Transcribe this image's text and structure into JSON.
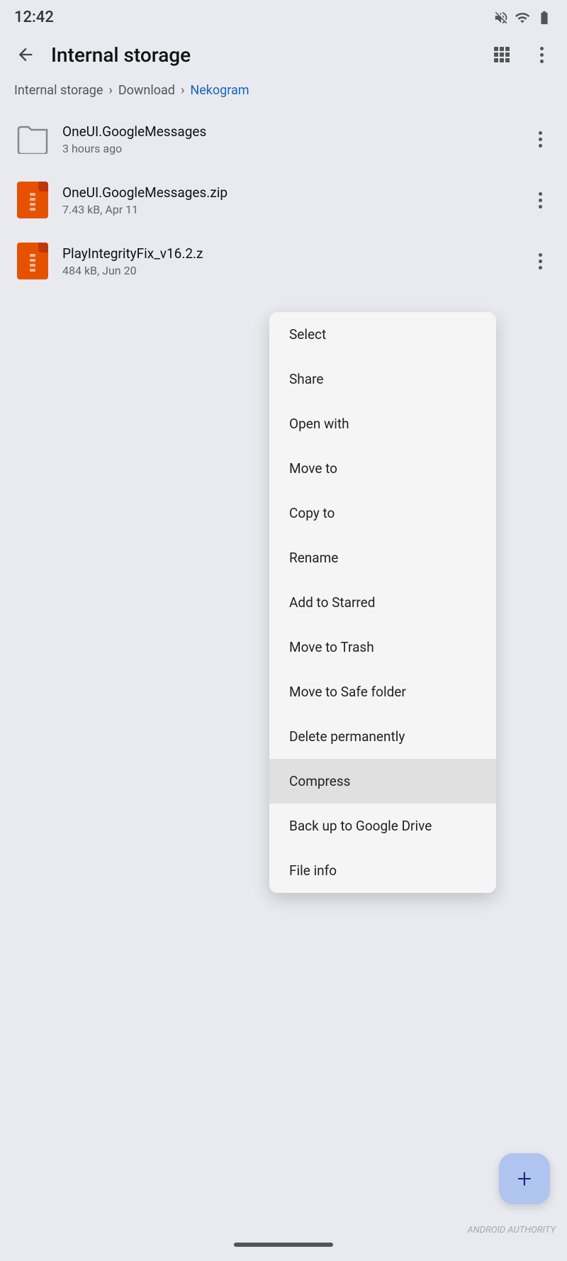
{
  "statusBar": {
    "time": "12:42",
    "terminalIcon": ">_",
    "muteIcon": "mute",
    "wifiIcon": "wifi",
    "batteryIcon": "battery"
  },
  "appBar": {
    "title": "Internal storage",
    "backLabel": "back",
    "gridLabel": "grid view",
    "moreLabel": "more options"
  },
  "breadcrumb": {
    "items": [
      {
        "label": "Internal storage",
        "active": false
      },
      {
        "label": "Download",
        "active": false
      },
      {
        "label": "Nekogram",
        "active": true
      }
    ]
  },
  "files": [
    {
      "name": "OneUI.GoogleMessages",
      "meta": "3 hours ago",
      "type": "folder"
    },
    {
      "name": "OneUI.GoogleMessages.zip",
      "meta": "7.43 kB, Apr 11",
      "type": "zip"
    },
    {
      "name": "PlayIntegrityFix_v16.2.z",
      "meta": "484 kB, Jun 20",
      "type": "zip"
    }
  ],
  "contextMenu": {
    "items": [
      {
        "label": "Select",
        "highlighted": false
      },
      {
        "label": "Share",
        "highlighted": false
      },
      {
        "label": "Open with",
        "highlighted": false
      },
      {
        "label": "Move to",
        "highlighted": false
      },
      {
        "label": "Copy to",
        "highlighted": false
      },
      {
        "label": "Rename",
        "highlighted": false
      },
      {
        "label": "Add to Starred",
        "highlighted": false
      },
      {
        "label": "Move to Trash",
        "highlighted": false
      },
      {
        "label": "Move to Safe folder",
        "highlighted": false
      },
      {
        "label": "Delete permanently",
        "highlighted": false
      },
      {
        "label": "Compress",
        "highlighted": true
      },
      {
        "label": "Back up to Google Drive",
        "highlighted": false
      },
      {
        "label": "File info",
        "highlighted": false
      }
    ]
  },
  "fab": {
    "label": "+"
  },
  "watermark": "ANDROID AUTHORITY"
}
